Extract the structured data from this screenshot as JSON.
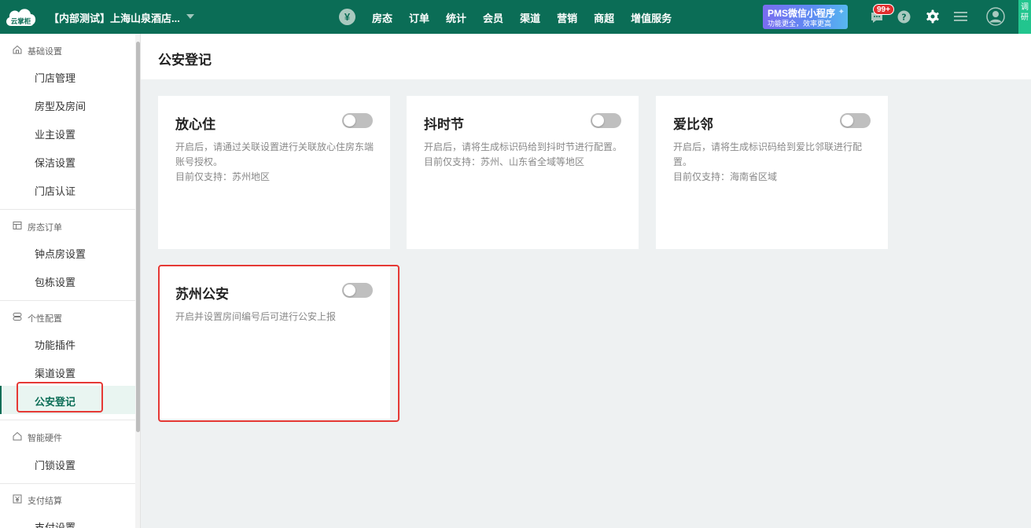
{
  "topbar": {
    "logo_text": "云掌柜",
    "store_name": "【内部测试】上海山泉酒店...",
    "currency_symbol": "¥",
    "nav": [
      "房态",
      "订单",
      "统计",
      "会员",
      "渠道",
      "营销",
      "商超",
      "增值服务"
    ],
    "promo_title": "PMS微信小程序",
    "promo_subtitle": "功能更全，效率更高",
    "message_badge": "99+",
    "side_tab_text": "调研",
    "brand_color": "#0b6d56",
    "promo_color": "#6a7df1",
    "badge_color": "#e02d2d"
  },
  "sidebar": {
    "groups": [
      {
        "label": "基础设置",
        "icon": "home-icon",
        "items": [
          "门店管理",
          "房型及房间",
          "业主设置",
          "保洁设置",
          "门店认证"
        ]
      },
      {
        "label": "房态订单",
        "icon": "calendar-icon",
        "items": [
          "钟点房设置",
          "包栋设置"
        ]
      },
      {
        "label": "个性配置",
        "icon": "layers-icon",
        "items": [
          "功能插件",
          "渠道设置",
          "公安登记"
        ]
      },
      {
        "label": "智能硬件",
        "icon": "home-icon",
        "items": [
          "门锁设置"
        ]
      },
      {
        "label": "支付结算",
        "icon": "yen-box-icon",
        "items": [
          "支付设置"
        ]
      }
    ],
    "active_item": "公安登记",
    "active_color": "#0b6d56",
    "highlight_color": "#e53935"
  },
  "page": {
    "title": "公安登记"
  },
  "cards": [
    {
      "title": "放心住",
      "lines": [
        "开启后，请通过关联设置进行关联放心住房东端账号授权。",
        "目前仅支持：苏州地区"
      ],
      "enabled": false
    },
    {
      "title": "抖时节",
      "lines": [
        "开启后，请将生成标识码给到抖时节进行配置。",
        "目前仅支持：苏州、山东省全域等地区"
      ],
      "enabled": false
    },
    {
      "title": "爱比邻",
      "lines": [
        "开启后，请将生成标识码给到爱比邻联进行配置。",
        "目前仅支持：海南省区域"
      ],
      "enabled": false
    },
    {
      "title": "苏州公安",
      "lines": [
        "开启并设置房间编号后可进行公安上报"
      ],
      "enabled": false
    }
  ]
}
